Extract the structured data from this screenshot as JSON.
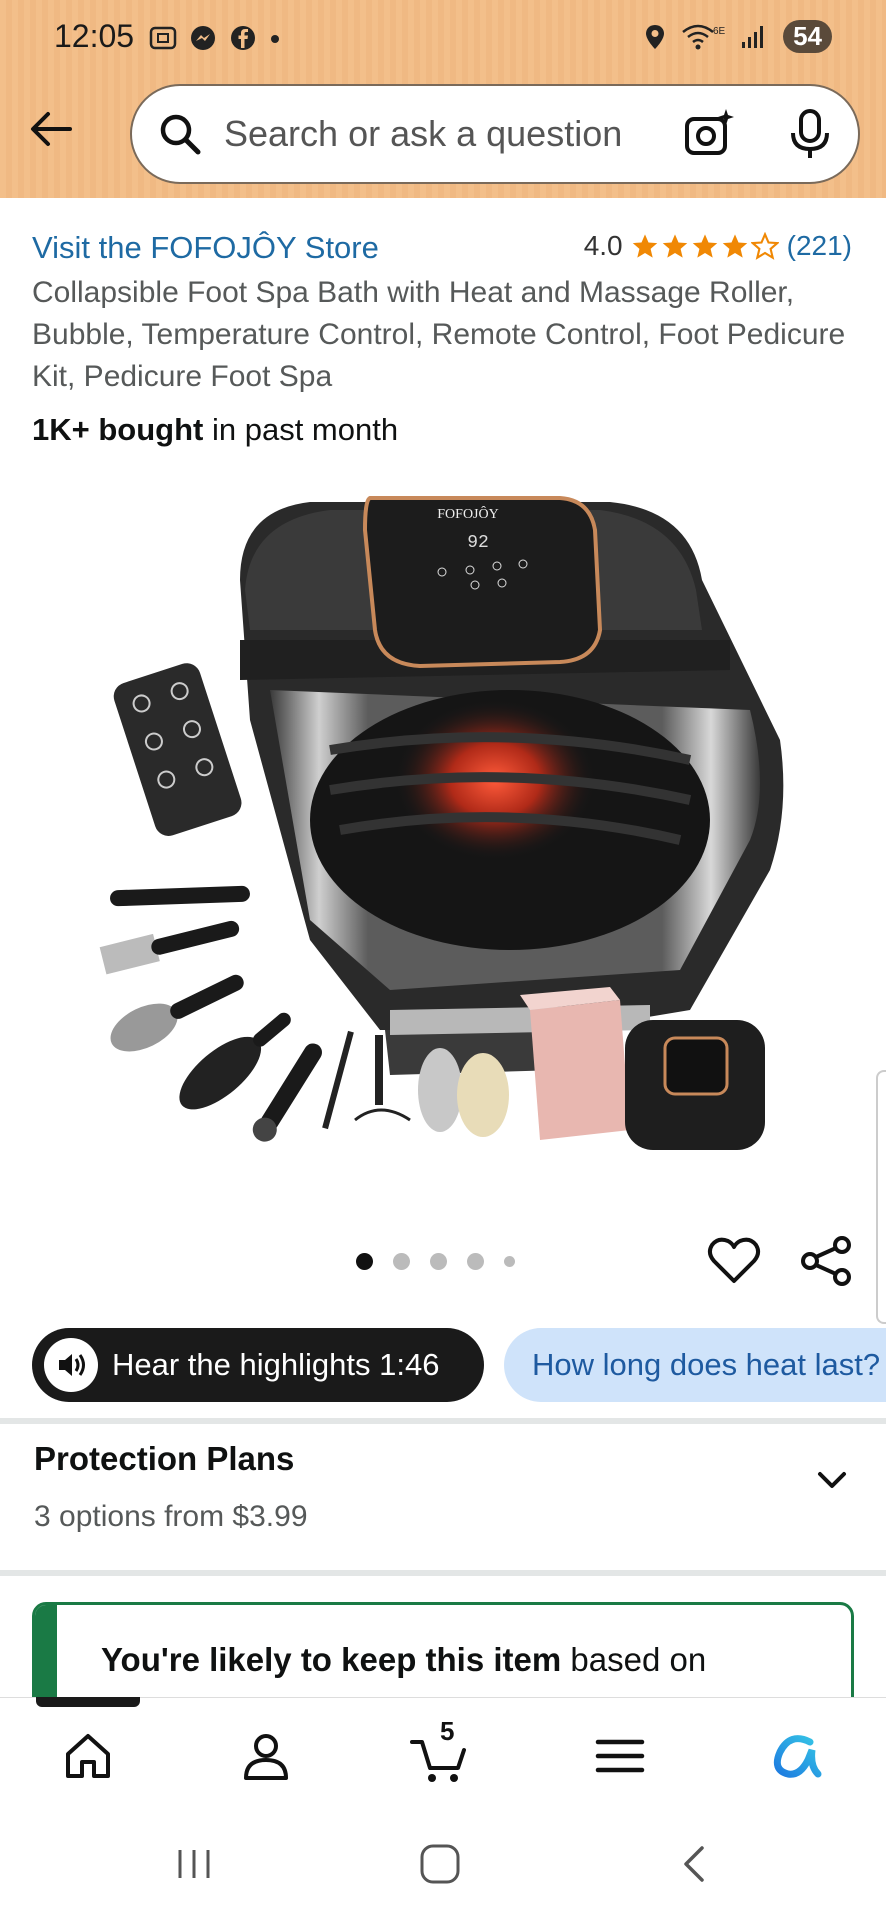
{
  "status_bar": {
    "time": "12:05",
    "network": "6E",
    "battery": "54"
  },
  "header": {
    "search_placeholder": "Search or ask a question"
  },
  "product": {
    "store_link": "Visit the FOFOJÔY Store",
    "rating": "4.0",
    "rating_stars": 4,
    "review_count": "(221)",
    "title": "Collapsible Foot Spa Bath with Heat and Massage Roller, Bubble, Temperature Control, Remote Control, Foot Pedicure Kit, Pedicure Foot Spa",
    "bought_bold": "1K+ bought",
    "bought_rest": " in past month",
    "image_brand": "FOFOJÔY",
    "image_display": "92",
    "carousel": {
      "count": 5,
      "active": 0
    }
  },
  "chips": {
    "highlights": "Hear the highlights 1:46",
    "question": "How long does heat last?"
  },
  "protection": {
    "title": "Protection Plans",
    "subtitle": "3 options from $3.99"
  },
  "likely": {
    "bold": "You're likely to keep this item",
    "rest": " based on"
  },
  "bottom_nav": {
    "items": [
      "home-icon",
      "account-icon",
      "cart-icon",
      "menu-icon",
      "rufus-icon"
    ],
    "cart_count": "5"
  },
  "colors": {
    "header_orange": "#f3bf8a",
    "link_blue": "#1e6aa3",
    "star_orange": "#f08804",
    "keep_green": "#1a7a45",
    "chip_blue": "#cfe3fa"
  }
}
